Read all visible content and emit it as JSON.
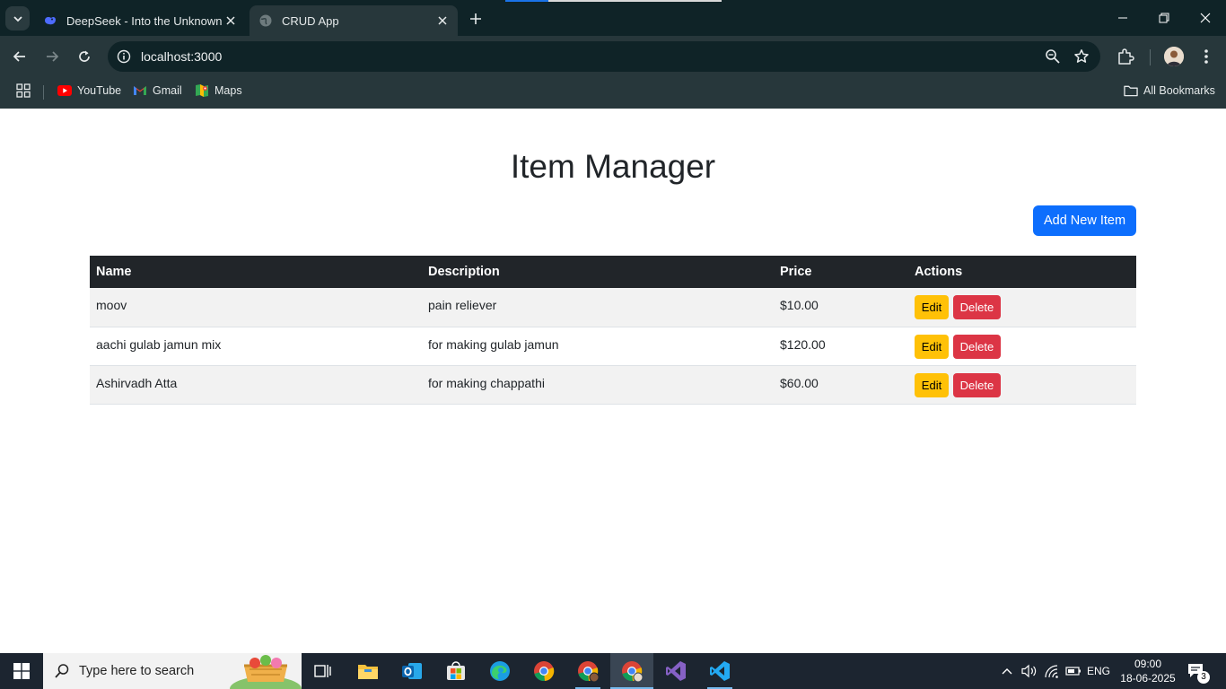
{
  "browser": {
    "tabs": [
      {
        "title": "DeepSeek - Into the Unknown",
        "active": false
      },
      {
        "title": "CRUD App",
        "active": true
      }
    ],
    "url": "localhost:3000",
    "bookmarks": [
      {
        "label": "YouTube",
        "icon": "youtube-icon"
      },
      {
        "label": "Gmail",
        "icon": "gmail-icon"
      },
      {
        "label": "Maps",
        "icon": "maps-icon"
      }
    ],
    "all_bookmarks_label": "All Bookmarks"
  },
  "page": {
    "title": "Item Manager",
    "add_button_label": "Add New Item",
    "table": {
      "headers": [
        "Name",
        "Description",
        "Price",
        "Actions"
      ],
      "rows": [
        {
          "name": "moov",
          "description": "pain reliever",
          "price": "$10.00"
        },
        {
          "name": "aachi gulab jamun mix",
          "description": "for making gulab jamun",
          "price": "$120.00"
        },
        {
          "name": "Ashirvadh Atta",
          "description": "for making chappathi",
          "price": "$60.00"
        }
      ],
      "edit_label": "Edit",
      "delete_label": "Delete"
    },
    "colors": {
      "primary": "#0d6efd",
      "warning": "#ffc107",
      "danger": "#dc3545",
      "table_header": "#212529"
    }
  },
  "taskbar": {
    "search_placeholder": "Type here to search",
    "language": "ENG",
    "time": "09:00",
    "date": "18-06-2025",
    "notification_count": "3"
  }
}
